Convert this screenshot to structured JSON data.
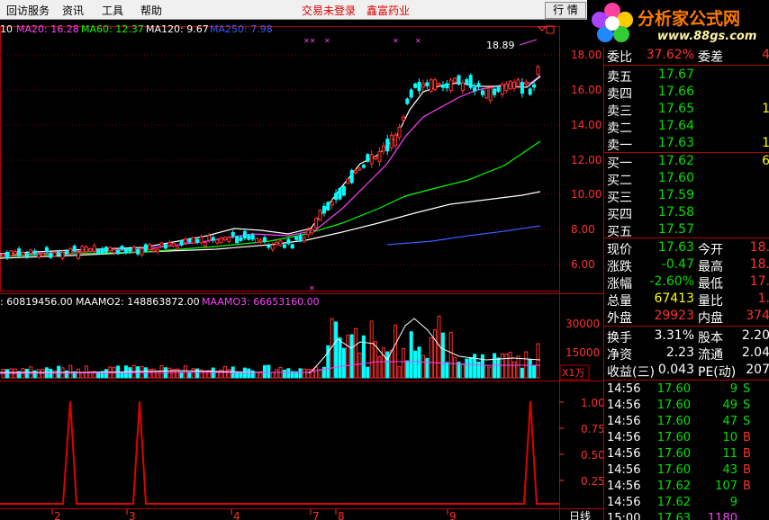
{
  "menu": {
    "items": [
      "回访服务",
      "资讯",
      "工具",
      "帮助"
    ],
    "status": "交易未登录",
    "stock_name": "鑫富药业",
    "quote_button": "行 情"
  },
  "logo": {
    "title": "分析家公式网",
    "url": "www.88gs.com"
  },
  "ma_bar": {
    "items": [
      {
        "text": "10",
        "color": "#ffffff"
      },
      {
        "text": "MA20: 16.28",
        "color": "#ff40ff"
      },
      {
        "text": "MA60: 12.37",
        "color": "#00ff00"
      },
      {
        "text": "MA120: 9.67",
        "color": "#ffffff"
      },
      {
        "text": "MA250: 7.98",
        "color": "#3a5bff"
      }
    ]
  },
  "price_axis": [
    "18.00",
    "16.00",
    "14.00",
    "12.00",
    "10.00",
    "8.00",
    "6.00"
  ],
  "high_label": "18.89",
  "vol_bar": {
    "items": [
      {
        "text": ": 60819456.00",
        "color": "#ffffff"
      },
      {
        "text": "MAAMO2: 148863872.00",
        "color": "#ffffff"
      },
      {
        "text": "MAAMO3: 66653160.00",
        "color": "#ff40ff"
      }
    ]
  },
  "vol_axis": [
    "30000",
    "15000"
  ],
  "vol_unit": "X1万",
  "ind_axis": [
    "1.00",
    "0.75",
    "0.50",
    "0.25"
  ],
  "date_axis": [
    "2",
    "3",
    "4",
    "7",
    "8",
    "9"
  ],
  "period": "日线",
  "colors": {
    "up": "#ff3030",
    "down": "#00ffff",
    "frame": "#b00000",
    "price": "#00e000",
    "neg": "#00e000",
    "pos": "#ff3030"
  },
  "quote": {
    "weibi": {
      "label": "委比",
      "value": "37.62%",
      "label2": "委差",
      "value2": "4"
    },
    "asks": [
      {
        "label": "卖五",
        "price": "17.67",
        "vol": ""
      },
      {
        "label": "卖四",
        "price": "17.66",
        "vol": ""
      },
      {
        "label": "卖三",
        "price": "17.65",
        "vol": "1"
      },
      {
        "label": "卖二",
        "price": "17.64",
        "vol": ""
      },
      {
        "label": "卖一",
        "price": "17.63",
        "vol": "1"
      }
    ],
    "bids": [
      {
        "label": "买一",
        "price": "17.62",
        "vol": "6"
      },
      {
        "label": "买二",
        "price": "17.60",
        "vol": ""
      },
      {
        "label": "买三",
        "price": "17.59",
        "vol": ""
      },
      {
        "label": "买四",
        "price": "17.58",
        "vol": ""
      },
      {
        "label": "买五",
        "price": "17.57",
        "vol": ""
      }
    ],
    "stats": [
      {
        "l1": "现价",
        "v1": "17.63",
        "c1": "#00e000",
        "l2": "今开",
        "v2": "18."
      },
      {
        "l1": "涨跌",
        "v1": "-0.47",
        "c1": "#00e000",
        "l2": "最高",
        "v2": "18."
      },
      {
        "l1": "涨幅",
        "v1": "-2.60%",
        "c1": "#00e000",
        "l2": "最低",
        "v2": "17."
      },
      {
        "l1": "总量",
        "v1": "67413",
        "c1": "#ffff00",
        "l2": "量比",
        "v2": "1."
      },
      {
        "l1": "外盘",
        "v1": "29923",
        "c1": "#ff3030",
        "l2": "内盘",
        "v2": "374"
      }
    ],
    "stats2": [
      {
        "l1": "换手",
        "v1": "3.31%",
        "l2": "股本",
        "v2": "2.20"
      },
      {
        "l1": "净资",
        "v1": "2.23",
        "l2": "流通",
        "v2": "2.04"
      },
      {
        "l1": "收益(三)",
        "v1": "0.043",
        "l2": "PE(动)",
        "v2": "207"
      }
    ],
    "ticks": [
      {
        "time": "14:56",
        "price": "17.60",
        "vol": "9",
        "bs": "S"
      },
      {
        "time": "14:56",
        "price": "17.60",
        "vol": "49",
        "bs": "S"
      },
      {
        "time": "14:56",
        "price": "17.60",
        "vol": "47",
        "bs": "S"
      },
      {
        "time": "14:56",
        "price": "17.60",
        "vol": "10",
        "bs": "B"
      },
      {
        "time": "14:56",
        "price": "17.60",
        "vol": "11",
        "bs": "B"
      },
      {
        "time": "14:56",
        "price": "17.60",
        "vol": "43",
        "bs": "B"
      },
      {
        "time": "14:56",
        "price": "17.62",
        "vol": "107",
        "bs": "B"
      },
      {
        "time": "14:56",
        "price": "17.62",
        "vol": "9",
        "bs": ""
      },
      {
        "time": "15:00",
        "price": "17.63",
        "vol": "1180",
        "bs": ""
      }
    ]
  }
}
